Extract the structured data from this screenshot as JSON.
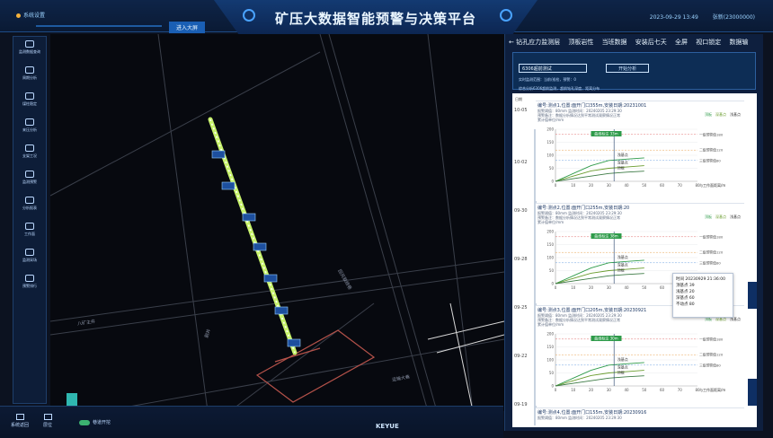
{
  "header": {
    "home_label": "系统设置",
    "title": "矿压大数据智能预警与决策平台",
    "enter_tab": "进入大屏",
    "user_time": "2023-09-29 13:49",
    "user_name": "张新(23000000)"
  },
  "sidebar": {
    "items": [
      {
        "label": "监测数据查询",
        "icon": "doc-icon"
      },
      {
        "label": "周期分析",
        "icon": "chart-icon"
      },
      {
        "label": "煤柱稳定",
        "icon": "layers-icon"
      },
      {
        "label": "来压分析",
        "icon": "cloud-icon"
      },
      {
        "label": "支架工况",
        "icon": "support-icon"
      },
      {
        "label": "监测预警",
        "icon": "alert-icon"
      },
      {
        "label": "分析报表",
        "icon": "report-icon"
      },
      {
        "label": "工作面",
        "icon": "face-icon"
      },
      {
        "label": "监测采场",
        "icon": "db-icon"
      },
      {
        "label": "预警排行",
        "icon": "rank-icon"
      }
    ]
  },
  "map": {
    "labels": [
      "八矿主井",
      "回风联络巷",
      "副井",
      "运输大巷"
    ]
  },
  "bottom": {
    "btn1": "系统返回",
    "btn2": "层位",
    "toggle": "巷道开挖",
    "brand": "KEYUE"
  },
  "panel": {
    "back": "← 钻孔应力监测层",
    "tabs": [
      "顶板岩性",
      "当班数据",
      "安装后七天",
      "全屏",
      "视口锁定",
      "数据输"
    ],
    "select_value": "6306超前测试",
    "analyze_btn": "开始分析",
    "info1": "实时监测范围：当前/巡检，预警：0",
    "info2": "综合分析6306超前监测，超前钻孔深度、距离分布"
  },
  "list": {
    "axis_label": "日期",
    "ylabels": [
      "10-05",
      "10-02",
      "09-30",
      "09-28",
      "09-25",
      "09-22",
      "09-19"
    ]
  },
  "cards": [
    {
      "title": "编号:测点1,位置:面开门口355m,安装日期:20231001",
      "meta": "报警阈值：80mm   监测时间：20240205 23:29:30",
      "note": "预警备注：数据分析情况达到平常测试观察情况正常",
      "peak": "曲线标注 33m",
      "series_label": "累计值单位/mm",
      "legend": [
        "顶板",
        "深基点",
        "浅基点"
      ]
    },
    {
      "title": "编号:测点2,位置:面开门口255m,安装日期:20",
      "meta": "报警阈值：80mm   监测时间：20240205 23:29:30",
      "note": "预警备注：数据分析情况达到平常测试观察情况正常",
      "peak": "曲线标注 38m",
      "series_label": "累计值单位/mm",
      "legend": [
        "顶板",
        "深基点",
        "浅基点"
      ]
    },
    {
      "title": "编号:测点3,位置:面开门口205m,安装日期:20230921",
      "meta": "报警阈值：80mm   监测时间：20240205 23:29:30",
      "note": "预警备注：数据分析情况达到平常测试观察情况正常",
      "peak": "曲线标注 30m",
      "series_label": "累计值单位/mm",
      "legend": [
        "顶板",
        "深基点",
        "浅基点"
      ]
    },
    {
      "title": "编号:测点4,位置:面开门口155m,安装日期:20230916",
      "meta": "报警阈值：80mm   监测时间：20240205 23:29:30"
    }
  ],
  "tooltip": {
    "time": "时间 20230929 21:36:00",
    "r1": "顶基点 39",
    "r2": "浅基点 20",
    "r3": "深基点 60",
    "r4": "不动点 80"
  },
  "chart_data": {
    "type": "line",
    "xlabel": "与工作面距离/m",
    "ylabel": "累计值单位/mm",
    "ylim": [
      0,
      200
    ],
    "x": [
      0,
      10,
      20,
      30,
      40,
      50,
      60,
      70,
      80
    ],
    "thresholds": [
      {
        "name": "一级预警值180",
        "value": 180
      },
      {
        "name": "二级预警值120",
        "value": 120
      },
      {
        "name": "三级预警值80",
        "value": 80
      }
    ],
    "series": [
      {
        "name": "浅基点",
        "values": [
          0,
          30,
          60,
          80,
          85,
          90,
          null,
          null,
          null
        ]
      },
      {
        "name": "深基点",
        "values": [
          0,
          20,
          40,
          50,
          55,
          60,
          null,
          null,
          null
        ]
      },
      {
        "name": "顶板",
        "values": [
          0,
          10,
          20,
          30,
          35,
          39,
          null,
          null,
          null
        ]
      }
    ]
  }
}
